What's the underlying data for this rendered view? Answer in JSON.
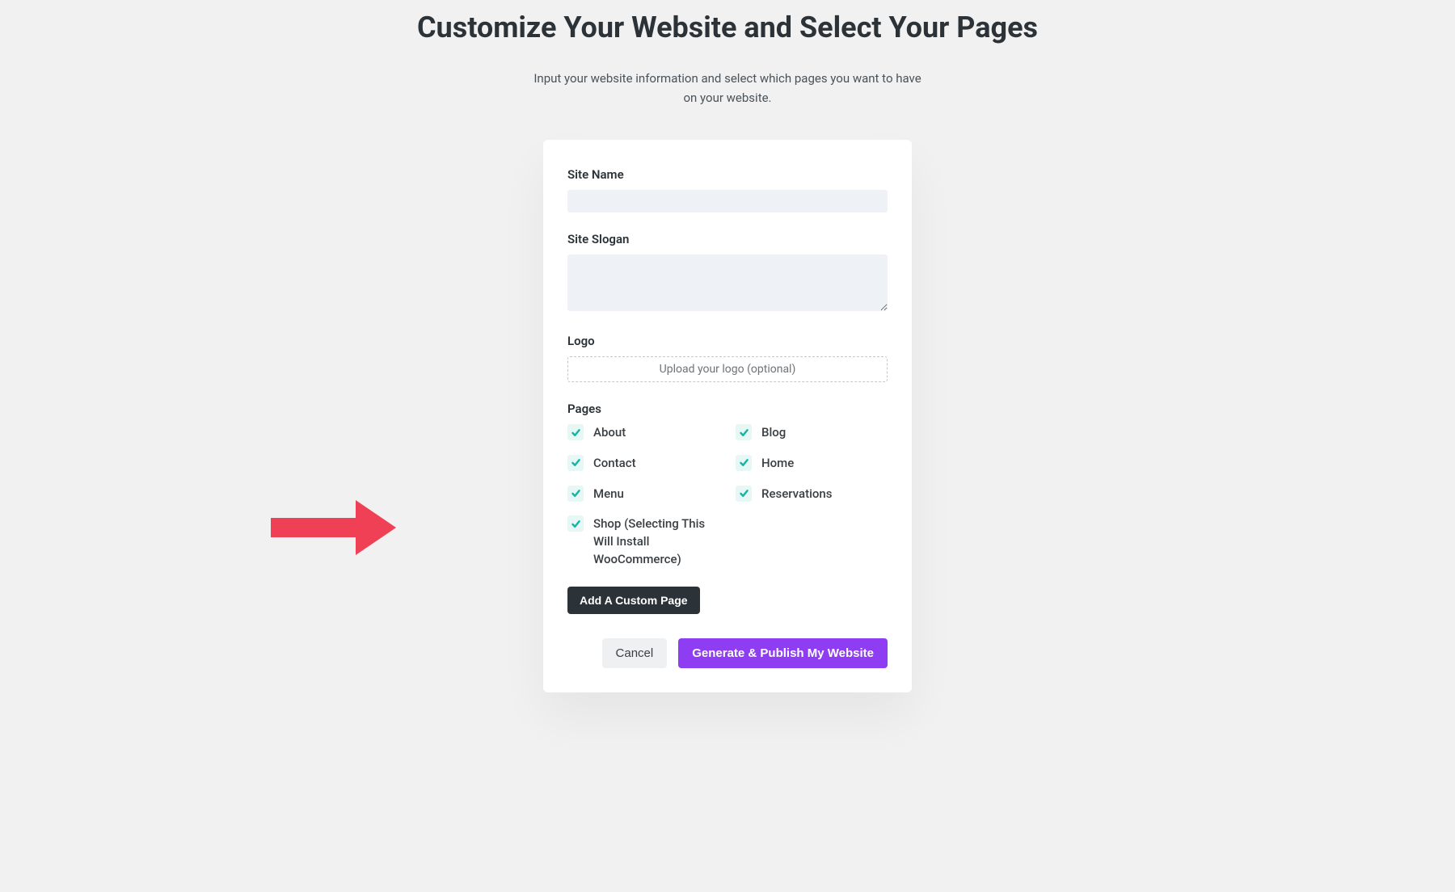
{
  "header": {
    "title": "Customize Your Website and Select Your Pages",
    "subtitle": "Input your website information and select which pages you want to have on your website."
  },
  "form": {
    "site_name_label": "Site Name",
    "site_name_value": "",
    "site_slogan_label": "Site Slogan",
    "site_slogan_value": "",
    "logo_label": "Logo",
    "logo_upload_text": "Upload your logo (optional)",
    "pages_label": "Pages",
    "pages": [
      {
        "label": "About",
        "checked": true
      },
      {
        "label": "Blog",
        "checked": true
      },
      {
        "label": "Contact",
        "checked": true
      },
      {
        "label": "Home",
        "checked": true
      },
      {
        "label": "Menu",
        "checked": true
      },
      {
        "label": "Reservations",
        "checked": true
      },
      {
        "label": "Shop (Selecting This Will Install WooCommerce)",
        "checked": true
      }
    ],
    "add_custom_page_label": "Add A Custom Page"
  },
  "actions": {
    "cancel_label": "Cancel",
    "publish_label": "Generate & Publish My Website"
  },
  "colors": {
    "checkbox_bg": "#e6f7f6",
    "checkbox_check": "#17b3a3",
    "primary_btn": "#8f3df2",
    "arrow": "#ef4056"
  }
}
